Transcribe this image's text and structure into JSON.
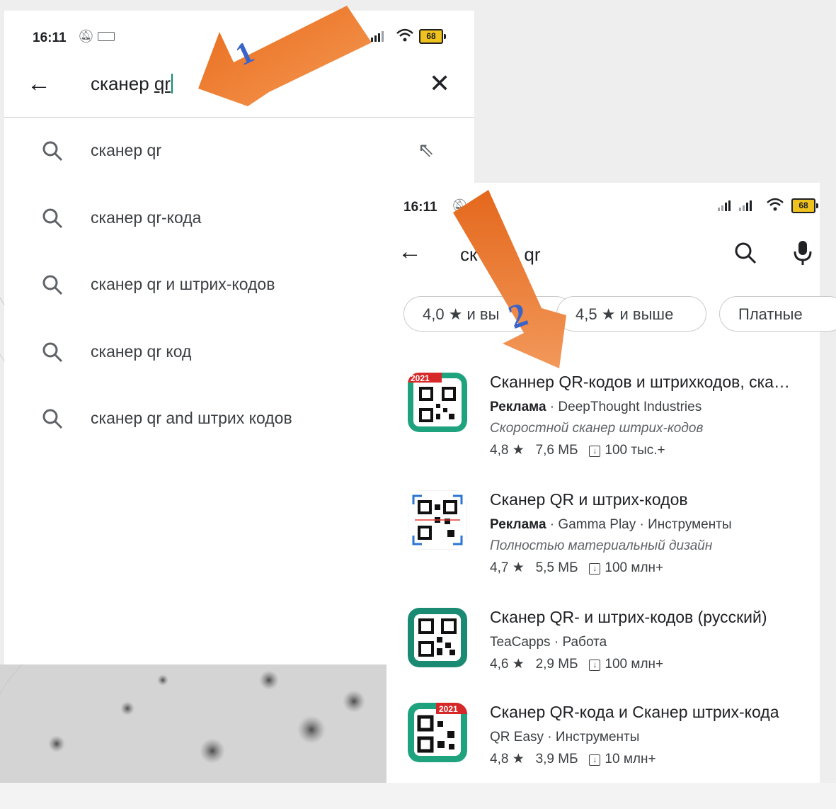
{
  "screen1": {
    "status": {
      "time": "16:11",
      "battery": "68"
    },
    "search": {
      "query_prefix": "сканер ",
      "query_qr": "qr"
    },
    "suggestions": [
      {
        "text": "сканер qr"
      },
      {
        "text": "сканер qr-кода"
      },
      {
        "text": "сканер qr и штрих-кодов"
      },
      {
        "text": "сканер qr код"
      },
      {
        "text": "сканер qr and штрих кодов"
      }
    ]
  },
  "screen2": {
    "status": {
      "time": "16:11",
      "battery": "68"
    },
    "search": {
      "query_visible": "ск",
      "query_tail": "qr"
    },
    "filters": [
      {
        "label": "4,0 ★ и вы"
      },
      {
        "label": "4,5 ★ и выше"
      },
      {
        "label": "Платные"
      }
    ],
    "apps": [
      {
        "title": "Сканнер QR-кодов и штрихкодов, ска…",
        "ad": "Реклама",
        "developer": "DeepThought Industries",
        "category": "",
        "description": "Скоростной сканер штрих-кодов",
        "rating": "4,8 ★",
        "size": "7,6 МБ",
        "downloads": "100 тыс.+",
        "badge": "2021"
      },
      {
        "title": "Сканер QR и штрих-кодов",
        "ad": "Реклама",
        "developer": "Gamma Play",
        "category": "Инструменты",
        "description": "Полностью материальный дизайн",
        "rating": "4,7 ★",
        "size": "5,5 МБ",
        "downloads": "100 млн+",
        "badge": ""
      },
      {
        "title": "Сканер QR- и штрих-кодов (русский)",
        "ad": "",
        "developer": "TeaCapps",
        "category": "Работа",
        "description": "",
        "rating": "4,6 ★",
        "size": "2,9 МБ",
        "downloads": "100 млн+",
        "badge": ""
      },
      {
        "title": "Сканер QR-кода и Сканер штрих-кода",
        "ad": "",
        "developer": "QR Easy",
        "category": "Инструменты",
        "description": "",
        "rating": "4,8 ★",
        "size": "3,9 МБ",
        "downloads": "10 млн+",
        "badge": "2021"
      }
    ]
  },
  "annotations": {
    "arrow1_label": "1",
    "arrow2_label": "2"
  },
  "colors": {
    "arrow": "#f07a28",
    "arrow_label": "#3a63c9",
    "accent": "#0b8d6a",
    "qr_teal": "#1fa37f"
  }
}
